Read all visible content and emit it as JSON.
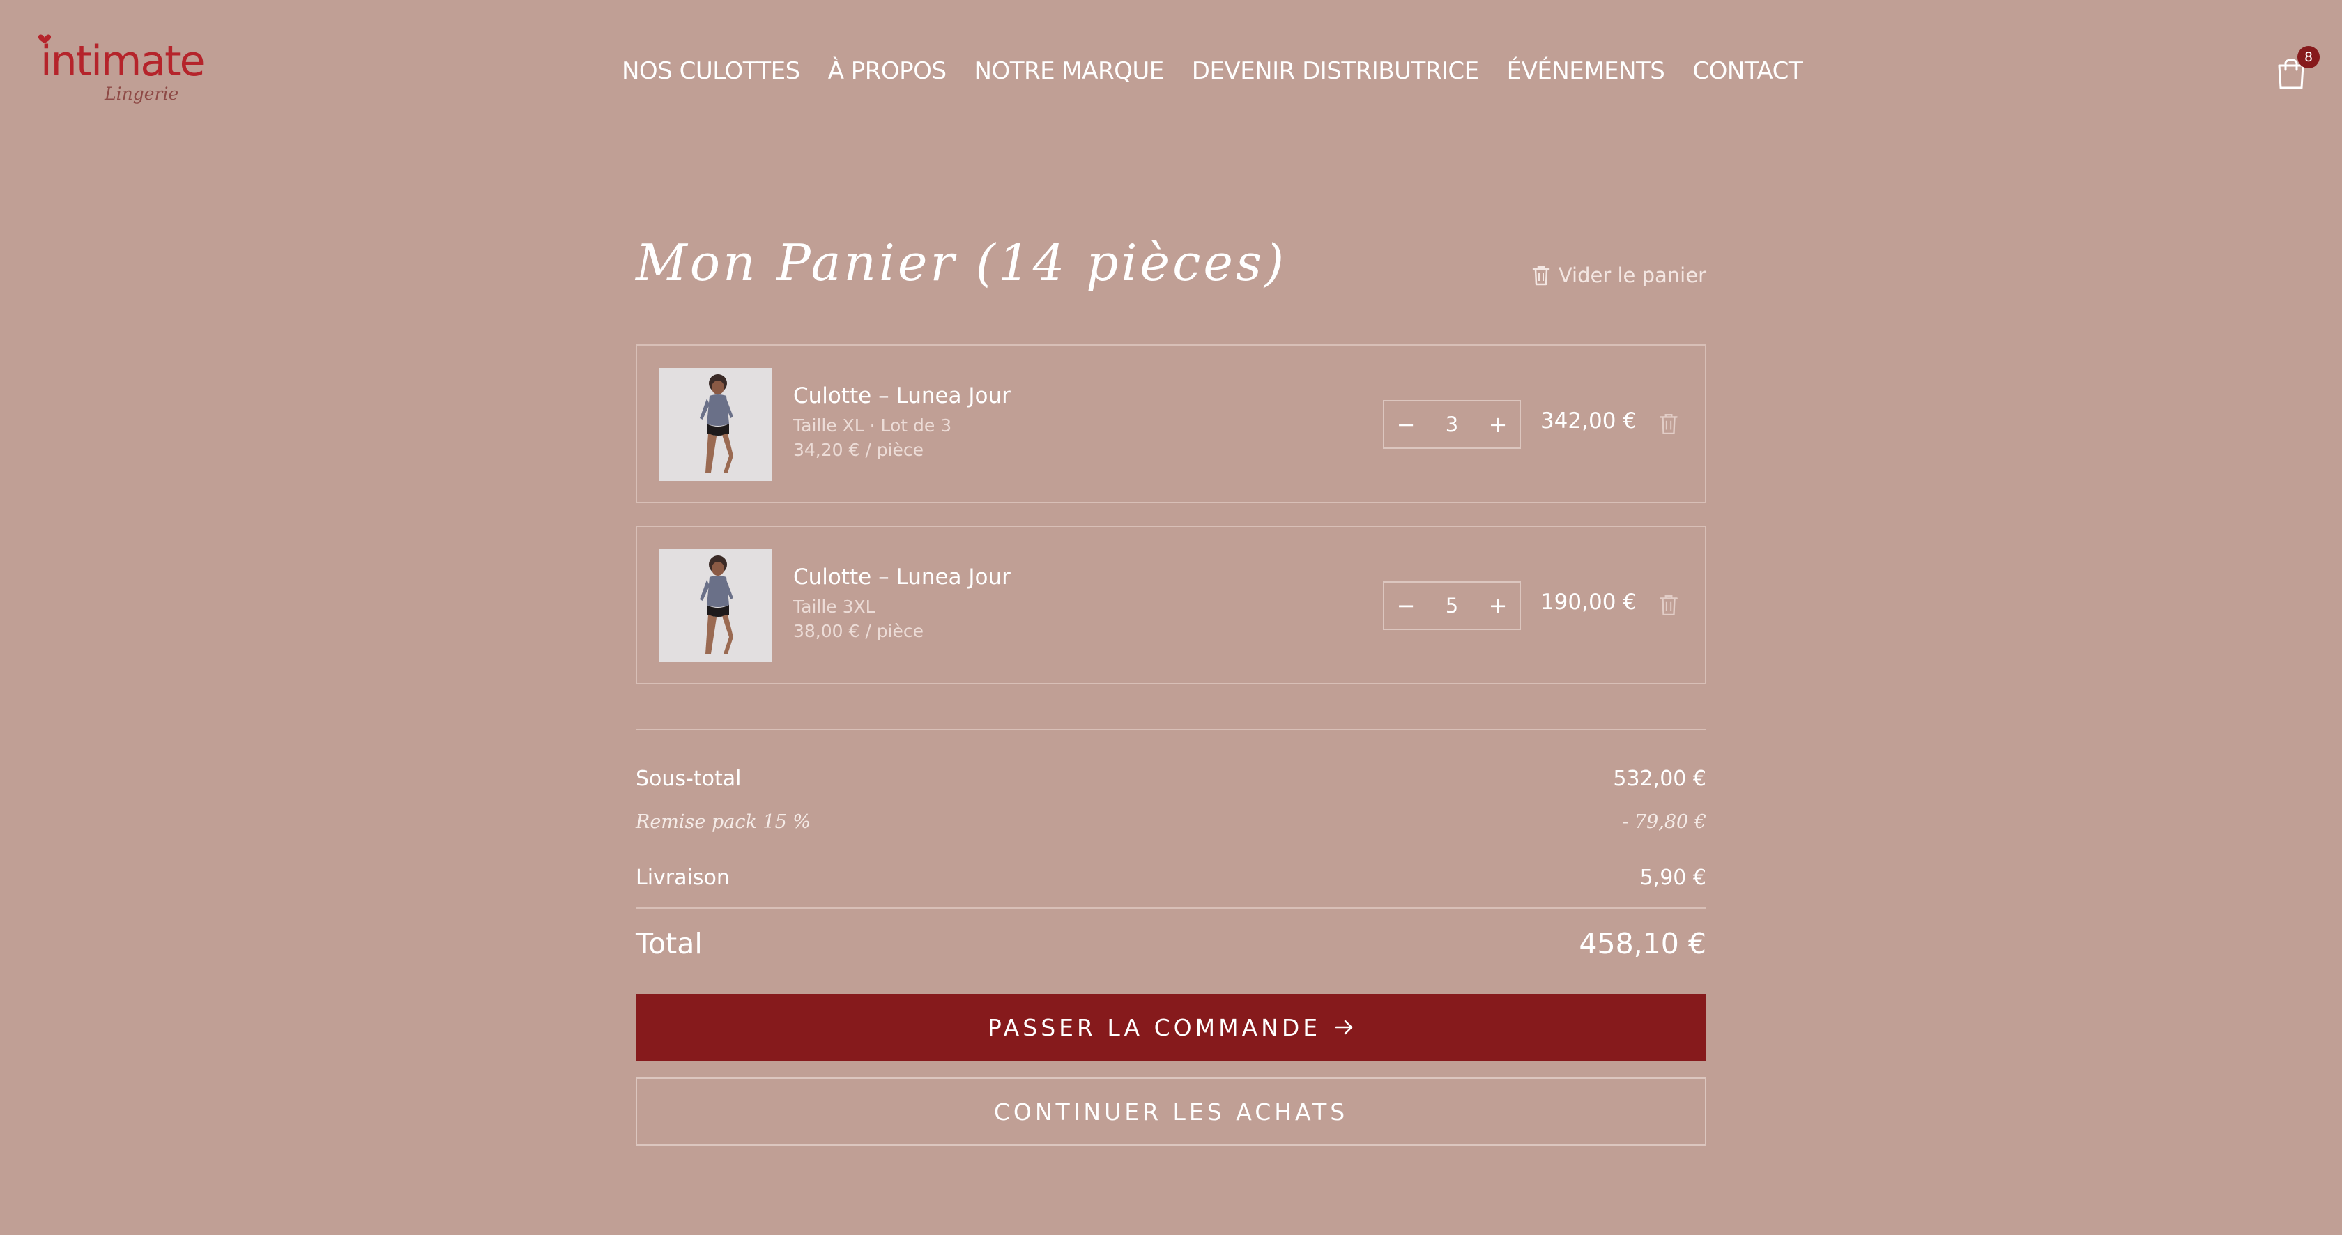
{
  "brand": {
    "logo_main": "intimate",
    "logo_sub": "Lingerie",
    "logo_icon": "heart-dot-icon"
  },
  "nav": [
    {
      "label": "NOS CULOTTES"
    },
    {
      "label": "À PROPOS"
    },
    {
      "label": "NOTRE MARQUE"
    },
    {
      "label": "DEVENIR DISTRIBUTRICE"
    },
    {
      "label": "ÉVÉNEMENTS"
    },
    {
      "label": "CONTACT"
    }
  ],
  "cart_icon": {
    "icon": "shopping-bag-icon",
    "badge": "8"
  },
  "cart": {
    "title": "Mon Panier (14 pièces)",
    "clear_label": "Vider le panier",
    "items": [
      {
        "name": "Culotte – Lunea Jour",
        "variant": "Taille XL · Lot de 3",
        "unit_price": "34,20 € / pièce",
        "quantity": "3",
        "price": "342,00 €"
      },
      {
        "name": "Culotte – Lunea Jour",
        "variant": "Taille 3XL",
        "unit_price": "38,00 € / pièce",
        "quantity": "5",
        "price": "190,00 €"
      }
    ],
    "qty_minus": "−",
    "qty_plus": "+"
  },
  "summary": {
    "subtotal_label": "Sous-total",
    "subtotal_value": "532,00 €",
    "discount_label": "Remise pack 15 %",
    "discount_value": "- 79,80 €",
    "shipping_label": "Livraison",
    "shipping_value": "5,90 €",
    "total_label": "Total",
    "total_value": "458,10 €"
  },
  "actions": {
    "checkout_label": "PASSER LA COMMANDE",
    "checkout_icon": "arrow-right-icon",
    "continue_label": "CONTINUER LES ACHATS"
  },
  "colors": {
    "background": "#c09f95",
    "accent": "#861a1c",
    "logo": "#b5242b"
  }
}
